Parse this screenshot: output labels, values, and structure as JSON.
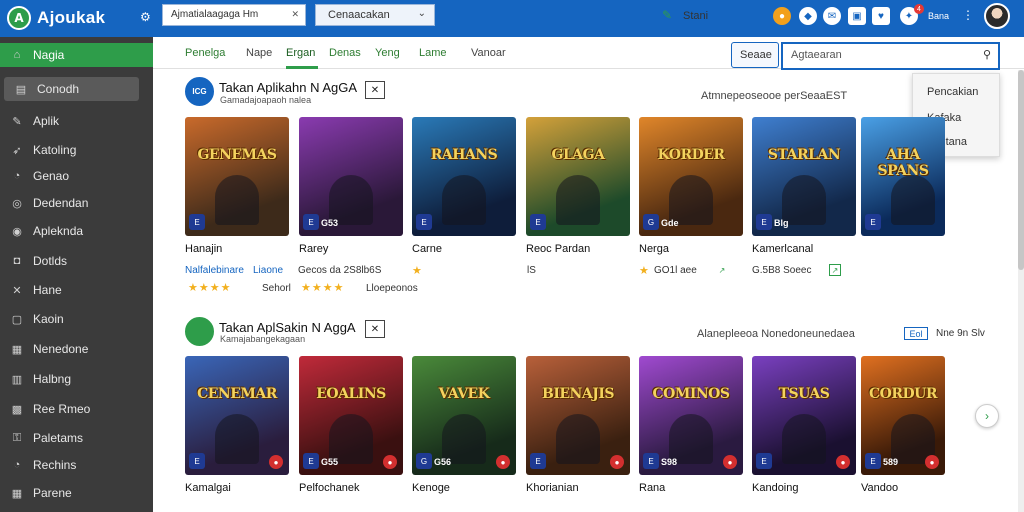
{
  "app": {
    "logo_mark": "A",
    "name": "Ajoukak"
  },
  "topbar": {
    "field1": "Ajmatialaagaga Hm",
    "field1_clear": "✕",
    "field2": "Cenaacakan",
    "icons": [
      "settings-icon",
      "coin-icon",
      "shield-icon",
      "message-icon",
      "heart-icon",
      "gift-icon"
    ],
    "notification_count": "4",
    "user_name": "Bana",
    "accent": "#1565c0"
  },
  "sidebar": {
    "items": [
      {
        "label": "Nagia",
        "icon": "home-icon",
        "active": true
      },
      {
        "label": "Conodh",
        "icon": "box-icon",
        "hover": true
      },
      {
        "label": "Aplik",
        "icon": "pencil-icon"
      },
      {
        "label": "Katoling",
        "icon": "pin-icon"
      },
      {
        "label": "Genao",
        "icon": "gauge-icon"
      },
      {
        "label": "Dedendan",
        "icon": "disc-icon"
      },
      {
        "label": "Apleknda",
        "icon": "coin-icon"
      },
      {
        "label": "Dotlds",
        "icon": "bag-icon"
      },
      {
        "label": "Hane",
        "icon": "tools-icon"
      },
      {
        "label": "Kaoin",
        "icon": "chat-icon"
      },
      {
        "label": "Nenedone",
        "icon": "doc-icon"
      },
      {
        "label": "Halbng",
        "icon": "chart-icon"
      },
      {
        "label": "Ree Rmeo",
        "icon": "flag-icon"
      },
      {
        "label": "Paletams",
        "icon": "key-icon"
      },
      {
        "label": "Rechins",
        "icon": "gauge-icon"
      },
      {
        "label": "Parene",
        "icon": "grid-icon"
      }
    ]
  },
  "tabs": [
    {
      "label": "Penelga"
    },
    {
      "label": "Nape"
    },
    {
      "label": "Ergan"
    },
    {
      "label": "Denas"
    },
    {
      "label": "Yeng"
    },
    {
      "label": "Lame"
    },
    {
      "label": "Vanoar"
    }
  ],
  "toolbar": {
    "pen_label": "Stani",
    "scope_label": "Seaae",
    "search_placeholder": "Agtaearan"
  },
  "dropdown": {
    "items": [
      "Pencakian",
      "Kafaka",
      "Yentana"
    ]
  },
  "sections": [
    {
      "title": "Takan Aplikahn N AgGA",
      "subtitle": "Gamadajoapaoh nalea",
      "badge": "ICG",
      "close": "✕",
      "right_text": "Atmnepeoseooe perSeaaEST",
      "cards": [
        {
          "art": "GENEMAS",
          "name": "Hanajin",
          "chip": "E",
          "chip_num": "",
          "colors": [
            "#3d2a1a",
            "#c96a2b"
          ]
        },
        {
          "art": "",
          "name": "Rarey",
          "chip": "E",
          "chip_num": "G53",
          "colors": [
            "#2a1838",
            "#8a3bb0"
          ]
        },
        {
          "art": "RAHANS",
          "name": "Carne",
          "chip": "E",
          "chip_num": "",
          "colors": [
            "#0e1d3a",
            "#2a7ab8"
          ]
        },
        {
          "art": "GLAGA",
          "name": "Reoc Pardan",
          "chip": "E",
          "chip_num": "",
          "colors": [
            "#1d4a2a",
            "#d4a13a"
          ]
        },
        {
          "art": "KORDER",
          "name": "Nerga",
          "chip": "G",
          "chip_num": "Gde",
          "colors": [
            "#4a2810",
            "#e0862a"
          ]
        },
        {
          "art": "STARLAN",
          "name": "Kamerlcanal",
          "chip": "E",
          "chip_num": "Blg",
          "colors": [
            "#12284a",
            "#3f7fd0"
          ]
        },
        {
          "art": "AHA SPANS",
          "name": "",
          "chip": "E",
          "chip_num": "",
          "colors": [
            "#0b2a5a",
            "#4aa0e6"
          ]
        }
      ],
      "meta_row1": [
        "Nalfalebinare",
        "Liaone",
        "Gecos da 2S8lb6S",
        "",
        "lS",
        "GO1l aee",
        "G.5B8 Soeec"
      ],
      "meta_row2_stars": "★★★★",
      "meta_row2": [
        "Sehorl",
        "Lloepeonos"
      ]
    },
    {
      "title": "Takan AplSakin N AggA",
      "subtitle": "Kamajabangekagaan",
      "badge": "",
      "close": "✕",
      "right_text": "Alanepleeoa Nonedoneunedaea",
      "tag": "Eol",
      "right_tail": "Nne 9n Slv",
      "cards": [
        {
          "art": "CENEMAR",
          "name": "Kamalgai",
          "chip": "E",
          "chip_num": "",
          "colors": [
            "#2a1d3d",
            "#3a66b8"
          ]
        },
        {
          "art": "EOALINS",
          "name": "Pelfochanek",
          "chip": "E",
          "chip_num": "G55",
          "colors": [
            "#3a1010",
            "#c02a3a"
          ]
        },
        {
          "art": "VAVEK",
          "name": "Kenoge",
          "chip": "G",
          "chip_num": "G56",
          "colors": [
            "#162a1a",
            "#4a8a3a"
          ]
        },
        {
          "art": "BIENAJIS",
          "name": "Khorianian",
          "chip": "E",
          "chip_num": "",
          "colors": [
            "#3a2010",
            "#b8603a"
          ]
        },
        {
          "art": "COMINOS",
          "name": "Rana",
          "chip": "E",
          "chip_num": "S98",
          "colors": [
            "#2a1a40",
            "#a04ad0"
          ]
        },
        {
          "art": "TSUAS",
          "name": "Kandoing",
          "chip": "E",
          "chip_num": "",
          "colors": [
            "#1a1030",
            "#7a40c0"
          ]
        },
        {
          "art": "CORDUR",
          "name": "Vandoo",
          "chip": "E",
          "chip_num": "589",
          "colors": [
            "#3a1a08",
            "#e07020"
          ]
        }
      ]
    }
  ],
  "next_label": "›"
}
